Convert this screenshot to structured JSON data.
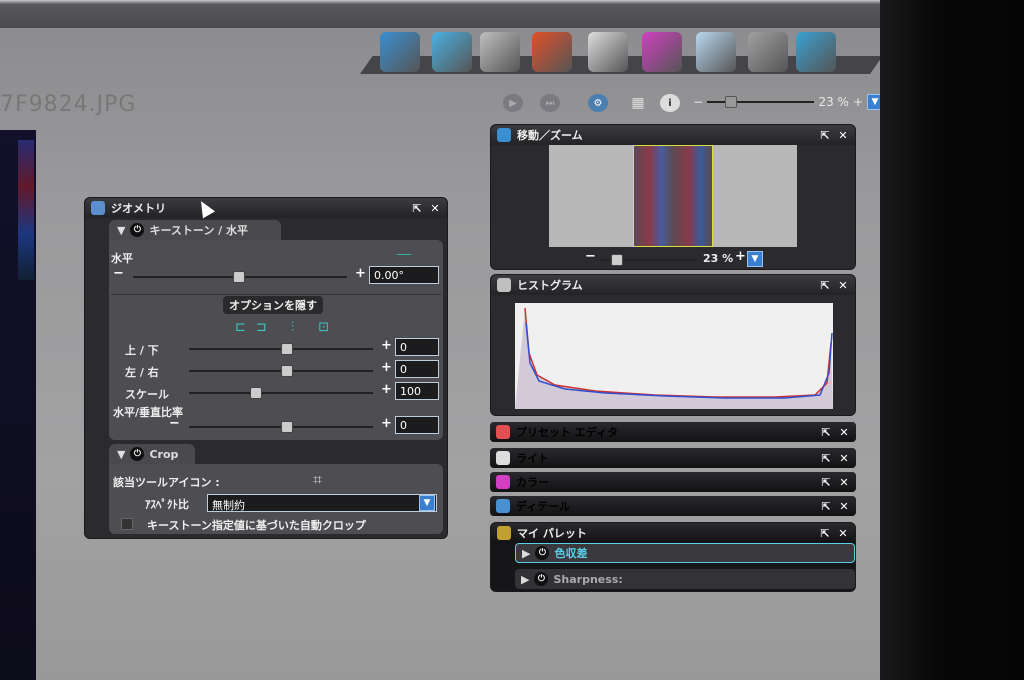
{
  "file_title": "7F9824.JPG",
  "toolbar": {
    "play_icon": "play-icon",
    "next_icon": "next-icon",
    "settings_icon": "gear-check-icon",
    "grid_icon": "grid-icon",
    "info_icon": "info-icon",
    "zoom_minus": "−",
    "zoom_plus": "+",
    "zoom_value": "23 %"
  },
  "modules": [
    {
      "name": "import-module-icon",
      "color": "#3a8fd0"
    },
    {
      "name": "browse-module-icon",
      "color": "#4ab0e0"
    },
    {
      "name": "tag-module-icon",
      "color": "#c0c0c0"
    },
    {
      "name": "export-module-icon",
      "color": "#e0502a"
    },
    {
      "name": "light-module-icon",
      "color": "#dddddd"
    },
    {
      "name": "color-module-icon",
      "color": "#d040c0"
    },
    {
      "name": "cube-module-icon",
      "color": "#b8d8f0"
    },
    {
      "name": "eye-module-icon",
      "color": "#a0a0a0"
    },
    {
      "name": "folder-user-module-icon",
      "color": "#3aa0d0"
    }
  ],
  "geometry_panel": {
    "title": "ジオメトリ",
    "keystone_tab": "キーストーン / 水平",
    "horizontal_label": "水平",
    "horizontal_value": "0.00°",
    "options_toggle": "オプションを隠す",
    "rows": [
      {
        "label": "上 / 下",
        "value": "0",
        "pos": 0.5
      },
      {
        "label": "左 / 右",
        "value": "0",
        "pos": 0.5
      },
      {
        "label": "スケール",
        "value": "100",
        "pos": 0.33
      },
      {
        "label": "水平/垂直比率",
        "value": "0",
        "pos": 0.5
      }
    ],
    "crop_tab": "Crop",
    "tool_icon_label": "該当ツールアイコン :",
    "aspect_label": "ｱｽﾍﾟｸﾄ比",
    "aspect_value": "無制約",
    "auto_crop_label": "キーストーン指定値に基づいた自動クロップ"
  },
  "navigator_panel": {
    "title": "移動／ズーム",
    "zoom_value": "23 %"
  },
  "histogram_panel": {
    "title": "ヒストグラム"
  },
  "collapsed_panels": [
    {
      "title": "プリセット エディタ",
      "icon": "preset-editor-icon"
    },
    {
      "title": "ライト",
      "icon": "light-icon"
    },
    {
      "title": "カラー",
      "icon": "color-wheel-icon"
    },
    {
      "title": "ディテール",
      "icon": "detail-icon"
    }
  ],
  "my_palette": {
    "title": "マイ パレット",
    "items": [
      "色収差",
      "Sharpness:"
    ]
  }
}
